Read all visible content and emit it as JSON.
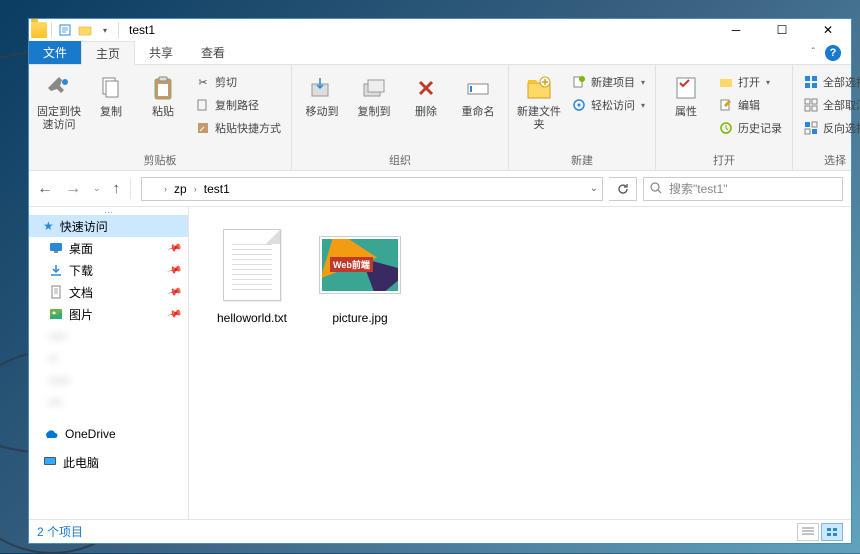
{
  "window": {
    "title": "test1"
  },
  "tabs": {
    "file": "文件",
    "home": "主页",
    "share": "共享",
    "view": "查看"
  },
  "ribbon": {
    "clipboard": {
      "pin": "固定到快速访问",
      "copy": "复制",
      "paste": "粘贴",
      "cut": "剪切",
      "copypath": "复制路径",
      "pasteshortcut": "粘贴快捷方式",
      "label": "剪贴板"
    },
    "organize": {
      "moveto": "移动到",
      "copyto": "复制到",
      "delete": "删除",
      "rename": "重命名",
      "label": "组织"
    },
    "new": {
      "newfolder": "新建文件夹",
      "newitem": "新建项目",
      "easyaccess": "轻松访问",
      "label": "新建"
    },
    "open": {
      "properties": "属性",
      "open": "打开",
      "edit": "编辑",
      "history": "历史记录",
      "label": "打开"
    },
    "select": {
      "all": "全部选择",
      "none": "全部取消",
      "invert": "反向选择",
      "label": "选择"
    }
  },
  "breadcrumbs": {
    "items": [
      "zp",
      "test1"
    ]
  },
  "search": {
    "placeholder": "搜索\"test1\""
  },
  "sidebar": {
    "quickaccess": "快速访问",
    "desktop": "桌面",
    "downloads": "下载",
    "documents": "文档",
    "pictures": "图片",
    "onedrive": "OneDrive",
    "thispc": "此电脑"
  },
  "files": [
    {
      "name": "helloworld.txt",
      "type": "txt"
    },
    {
      "name": "picture.jpg",
      "type": "img",
      "badge": "Web前端"
    }
  ],
  "status": {
    "count": "2 个项目"
  }
}
